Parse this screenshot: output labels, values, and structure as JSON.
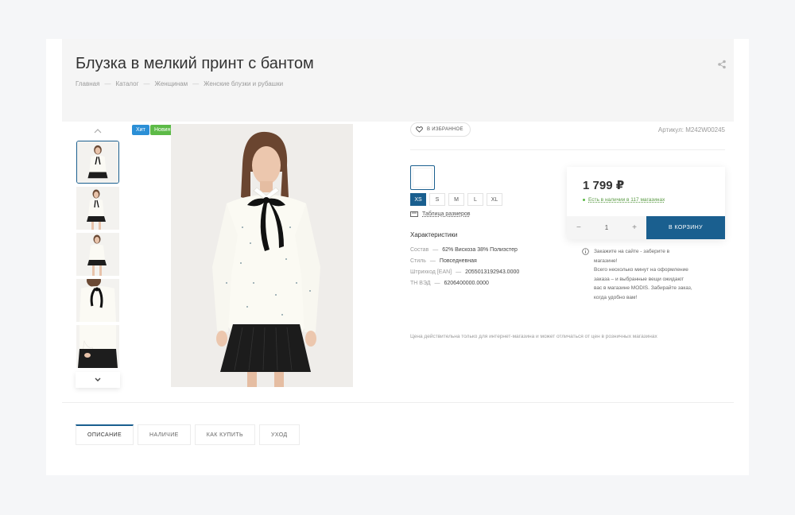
{
  "product": {
    "title": "Блузка в мелкий принт с бантом",
    "article_label": "Артикул: M242W00245",
    "badges": {
      "hit": "Хит",
      "new": "Новинка"
    },
    "favorite_label": "В ИЗБРАННОЕ"
  },
  "breadcrumb": [
    "Главная",
    "Каталог",
    "Женщинам",
    "Женские блузки и рубашки"
  ],
  "breadcrumb_separator": "—",
  "sizes": [
    {
      "label": "XS",
      "selected": true
    },
    {
      "label": "S",
      "selected": false
    },
    {
      "label": "M",
      "selected": false
    },
    {
      "label": "L",
      "selected": false
    },
    {
      "label": "XL",
      "selected": false
    }
  ],
  "size_table_label": "Таблица размеров",
  "characteristics": {
    "title": "Характеристики",
    "rows": [
      {
        "key": "Состав",
        "dash": "—",
        "value": "62% Вискоза 38% Полиэстер"
      },
      {
        "key": "Стиль",
        "dash": "—",
        "value": "Повседневная"
      },
      {
        "key": "Штрихкод [EAN]",
        "dash": "—",
        "value": "2055013192943.0000"
      },
      {
        "key": "ТН ВЭД",
        "dash": "—",
        "value": "6206400000.0000"
      }
    ]
  },
  "buy": {
    "price": "1 799 ₽",
    "stock": "Есть в наличии в 117 магазинах",
    "quantity": "1",
    "minus": "−",
    "plus": "+",
    "cart_label": "В КОРЗИНУ"
  },
  "info_lines": [
    "Закажите на сайте - заберите в",
    "магазине!",
    "Всего несколько минут на оформление",
    "заказа – и выбранные вещи ожидают",
    "вас в магазине MODIS. Забирайте заказ,",
    "когда удобно вам!"
  ],
  "price_note": "Цена действительна только для интернет-магазина и может отличаться от цен в розничных магазинах",
  "tabs": [
    {
      "label": "ОПИСАНИЕ",
      "active": true
    },
    {
      "label": "НАЛИЧИЕ",
      "active": false
    },
    {
      "label": "КАК КУПИТЬ",
      "active": false
    },
    {
      "label": "УХОД",
      "active": false
    }
  ],
  "colors": {
    "accent": "#1a5f8f",
    "stock_green": "#5cba47",
    "badge_hit": "#2b8fd6",
    "badge_new": "#5cba47"
  }
}
